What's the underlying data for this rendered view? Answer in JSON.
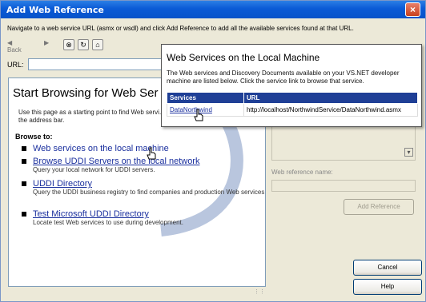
{
  "window": {
    "title": "Add Web Reference",
    "close_glyph": "×"
  },
  "instructions": "Navigate to a web service URL (asmx or wsdl) and click Add Reference to add all the available services found at that URL.",
  "toolbar": {
    "back_label": "Back",
    "icons": [
      "back-arrow-icon",
      "forward-arrow-icon",
      "stop-icon",
      "refresh-icon",
      "home-icon"
    ]
  },
  "url": {
    "label": "URL:",
    "value": ""
  },
  "browser": {
    "heading": "Start Browsing for Web Ser",
    "intro": "Use this page as a starting point to find Web servi... below, or type a known URL into the address bar.",
    "browse_to": "Browse to:",
    "links": [
      {
        "label": "Web services on the local machine",
        "desc": ""
      },
      {
        "label": "Browse UDDI Servers on the local network",
        "desc": "Query your local network for UDDI servers."
      },
      {
        "label": "UDDI Directory",
        "desc": "Query the UDDI business registry to find companies and production Web services."
      },
      {
        "label": "Test Microsoft UDDI Directory",
        "desc": "Locate test Web services to use during development."
      }
    ]
  },
  "right_panel": {
    "refname_label": "Web reference name:",
    "refname_value": "",
    "add_reference": "Add Reference"
  },
  "buttons": {
    "cancel": "Cancel",
    "help": "Help"
  },
  "popup": {
    "title": "Web Services on the Local Machine",
    "desc": "The Web services and Discovery Documents available on your VS.NET developer machine are listed below. Click the service link to browse that service.",
    "columns": [
      "Services",
      "URL"
    ],
    "rows": [
      {
        "service": "DataNorthwind",
        "url": "http://localhost/NorthwindService/DataNorthwind.asmx"
      }
    ]
  },
  "colors": {
    "title_bar": "#0a5ad6",
    "table_header": "#1f3f96",
    "link": "#1a2f9e"
  }
}
